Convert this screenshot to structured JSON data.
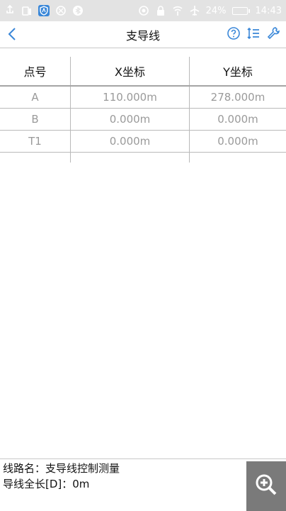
{
  "status_bar": {
    "battery": "24%",
    "time": "14:43",
    "icons": [
      "usb-icon",
      "sim-icon",
      "shield-icon",
      "sync-icon",
      "bluetooth-icon",
      "target-icon",
      "lock-icon",
      "signal-icon",
      "airplane-icon",
      "battery-icon"
    ]
  },
  "header": {
    "title": "支导线",
    "icons": [
      "back-icon",
      "help-icon",
      "list-icon",
      "settings-icon"
    ]
  },
  "table": {
    "columns": [
      "点号",
      "X坐标",
      "Y坐标"
    ],
    "rows": [
      [
        "A",
        "110.000m",
        "278.000m"
      ],
      [
        "B",
        "0.000m",
        "0.000m"
      ],
      [
        "T1",
        "0.000m",
        "0.000m"
      ]
    ]
  },
  "footer": {
    "line1": "线路名：支导线控制测量",
    "line2": "导线全长[D]：0m"
  },
  "colors": {
    "status_bg": "#e3e3e3",
    "accent": "#3a87d8",
    "header_bg": "#ffffff",
    "zoom_bg": "#7a7a7a",
    "value_text": "#9a9a9a"
  }
}
